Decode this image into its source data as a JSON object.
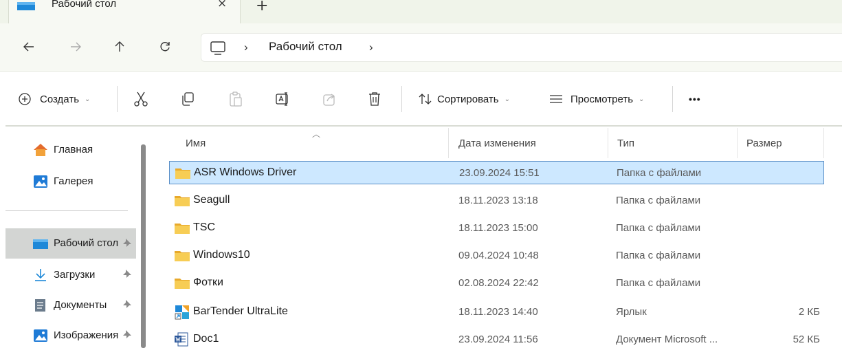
{
  "tab": {
    "title": "Рабочий стол",
    "close_glyph": "×",
    "new_tab_glyph": "+"
  },
  "nav": {
    "back_icon": "arrow-left-icon",
    "forward_icon": "arrow-right-icon",
    "up_icon": "arrow-up-icon",
    "refresh_icon": "refresh-icon"
  },
  "address": {
    "crumbs": [
      "Рабочий стол"
    ],
    "sep": "›"
  },
  "commands": {
    "create_label": "Создать",
    "sort_label": "Сортировать",
    "view_label": "Просмотреть",
    "more_label": "•••",
    "chevron": "⌄"
  },
  "sidebar": {
    "items": [
      {
        "label": "Главная",
        "icon": "home-icon"
      },
      {
        "label": "Галерея",
        "icon": "gallery-icon"
      },
      {
        "label": "Рабочий стол",
        "icon": "desktop-folder-icon",
        "pinned": true,
        "selected": true
      },
      {
        "label": "Загрузки",
        "icon": "download-icon",
        "pinned": true
      },
      {
        "label": "Документы",
        "icon": "documents-icon",
        "pinned": true
      },
      {
        "label": "Изображения",
        "icon": "pictures-icon",
        "pinned": true
      }
    ]
  },
  "columns": {
    "name": "Имя",
    "date": "Дата изменения",
    "type": "Тип",
    "size": "Размер"
  },
  "files": [
    {
      "name": "ASR Windows Driver",
      "date": "23.09.2024 15:51",
      "type": "Папка с файлами",
      "size": "",
      "icon": "folder-icon",
      "selected": true
    },
    {
      "name": "Seagull",
      "date": "18.11.2023 13:18",
      "type": "Папка с файлами",
      "size": "",
      "icon": "folder-icon"
    },
    {
      "name": "TSC",
      "date": "18.11.2023 15:00",
      "type": "Папка с файлами",
      "size": "",
      "icon": "folder-icon"
    },
    {
      "name": "Windows10",
      "date": "09.04.2024 10:48",
      "type": "Папка с файлами",
      "size": "",
      "icon": "folder-icon"
    },
    {
      "name": "Фотки",
      "date": "02.08.2024 22:42",
      "type": "Папка с файлами",
      "size": "",
      "icon": "folder-icon"
    },
    {
      "name": "BarTender UltraLite",
      "date": "18.11.2023 14:40",
      "type": "Ярлык",
      "size": "2 КБ",
      "icon": "bartender-shortcut-icon"
    },
    {
      "name": "Doc1",
      "date": "23.09.2024 11:56",
      "type": "Документ Microsoft ...",
      "size": "52 КБ",
      "icon": "word-document-icon"
    }
  ],
  "colors": {
    "selection_bg": "#cde8ff",
    "selection_border": "#5b8fc7",
    "folder": "#f5c542",
    "accent": "#0078d4"
  }
}
